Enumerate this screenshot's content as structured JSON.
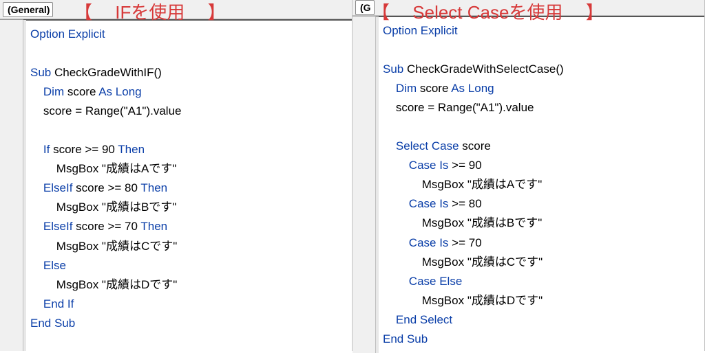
{
  "left": {
    "dropdown": "(General)",
    "title_open": "【",
    "title_text": "IFを使用",
    "title_close": "】",
    "option_explicit": "Option Explicit",
    "sub_kw": "Sub",
    "sub_name": " CheckGradeWithIF()",
    "dim_kw": "Dim",
    "dim_var": " score ",
    "as_long": "As Long",
    "assign": "score = Range(\"A1\").value",
    "if_kw": "If",
    "if_cond": " score >= 90 ",
    "then_kw": "Then",
    "msg_a": "MsgBox \"成績はAです\"",
    "elseif_kw": "ElseIf",
    "elseif80_cond": " score >= 80 ",
    "msg_b": "MsgBox \"成績はBです\"",
    "elseif70_cond": " score >= 70 ",
    "msg_c": "MsgBox \"成績はCです\"",
    "else_kw": "Else",
    "msg_d": "MsgBox \"成績はDです\"",
    "end_if": "End If",
    "end_sub": "End Sub"
  },
  "right": {
    "dropdown": "(G",
    "title_open": "【",
    "title_text": "Select Caseを使用",
    "title_close": "】",
    "option_explicit": "Option Explicit",
    "sub_kw": "Sub",
    "sub_name": " CheckGradeWithSelectCase()",
    "dim_kw": "Dim",
    "dim_var": " score ",
    "as_long": "As Long",
    "assign": "score = Range(\"A1\").value",
    "select_case": "Select Case",
    "select_var": " score",
    "case_is": "Case Is",
    "ge90": " >= 90",
    "msg_a": "MsgBox \"成績はAです\"",
    "ge80": " >= 80",
    "msg_b": "MsgBox \"成績はBです\"",
    "ge70": " >= 70",
    "msg_c": "MsgBox \"成績はCです\"",
    "case_else": "Case Else",
    "msg_d": "MsgBox \"成績はDです\"",
    "end_select": "End Select",
    "end_sub": "End Sub"
  }
}
